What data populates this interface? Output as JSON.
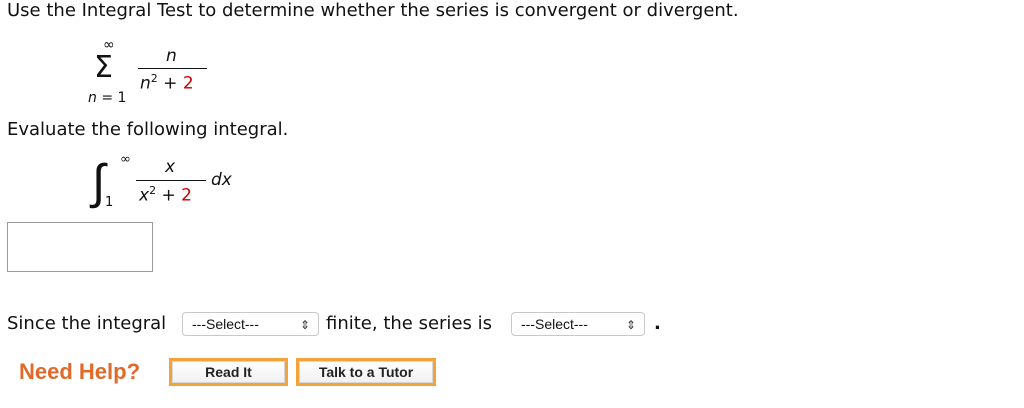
{
  "question": {
    "prompt": "Use the Integral Test to determine whether the series is convergent or divergent.",
    "series": {
      "upper_limit": "∞",
      "lower_limit": "n = 1",
      "numerator": "n",
      "denominator_base": "n",
      "denominator_exp": "2",
      "denominator_plus": " + ",
      "denominator_const": "2"
    },
    "integral_prompt": "Evaluate the following integral.",
    "integral": {
      "upper_limit": "∞",
      "lower_limit": "1",
      "numerator": "x",
      "denominator_base": "x",
      "denominator_exp": "2",
      "denominator_plus": " + ",
      "denominator_const": "2",
      "differential": "dx"
    },
    "answer_value": "",
    "conclusion": {
      "text_before": "Since the integral",
      "select1": "---Select---",
      "text_middle": "finite, the series is",
      "select2": "---Select---",
      "text_end": "."
    }
  },
  "help": {
    "label": "Need Help?",
    "read_it": "Read It",
    "talk_tutor": "Talk to a Tutor"
  },
  "icons": {
    "select_arrow": "updown-chevron-icon"
  }
}
